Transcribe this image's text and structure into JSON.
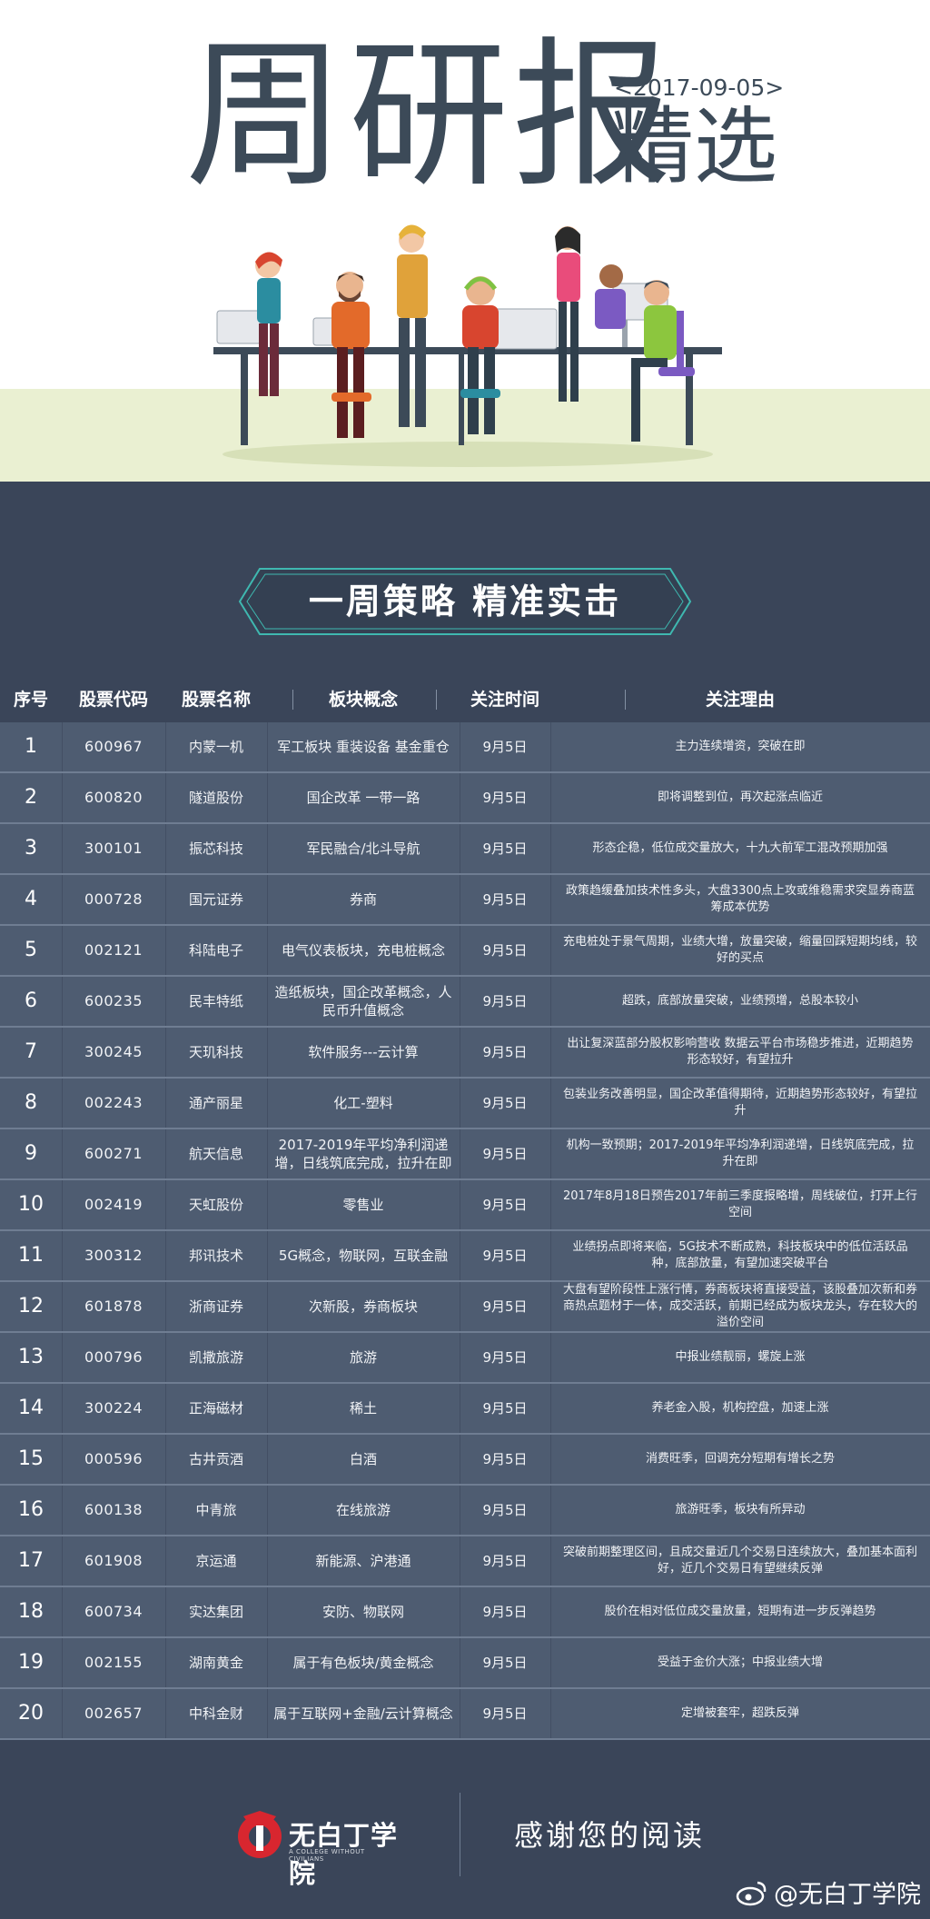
{
  "header": {
    "title_main": "周研报",
    "title_sub": "精选",
    "date": "<2017-09-05>"
  },
  "banner": {
    "text": "一周策略  精准实击"
  },
  "table": {
    "columns": [
      "序号",
      "股票代码",
      "股票名称",
      "板块概念",
      "关注时间",
      "关注理由"
    ],
    "rows": [
      {
        "no": "1",
        "code": "600967",
        "name": "内蒙一机",
        "concept": "军工板块 重装设备 基金重仓",
        "time": "9月5日",
        "reason": "主力连续增资，突破在即"
      },
      {
        "no": "2",
        "code": "600820",
        "name": "隧道股份",
        "concept": "国企改革 一带一路",
        "time": "9月5日",
        "reason": "即将调整到位，再次起涨点临近"
      },
      {
        "no": "3",
        "code": "300101",
        "name": "振芯科技",
        "concept": "军民融合/北斗导航",
        "time": "9月5日",
        "reason": "形态企稳，低位成交量放大，十九大前军工混改预期加强"
      },
      {
        "no": "4",
        "code": "000728",
        "name": "国元证券",
        "concept": "券商",
        "time": "9月5日",
        "reason": "政策趋缓叠加技术性多头，大盘3300点上攻或维稳需求突显券商蓝筹成本优势"
      },
      {
        "no": "5",
        "code": "002121",
        "name": "科陆电子",
        "concept": "电气仪表板块，充电桩概念",
        "time": "9月5日",
        "reason": "充电桩处于景气周期，业绩大增，放量突破，缩量回踩短期均线，较好的买点"
      },
      {
        "no": "6",
        "code": "600235",
        "name": "民丰特纸",
        "concept": "造纸板块，国企改革概念，人民币升值概念",
        "time": "9月5日",
        "reason": "超跌，底部放量突破，业绩预增，总股本较小"
      },
      {
        "no": "7",
        "code": "300245",
        "name": "天玑科技",
        "concept": "软件服务---云计算",
        "time": "9月5日",
        "reason": "出让复深蓝部分股权影响营收 数据云平台市场稳步推进，近期趋势形态较好，有望拉升"
      },
      {
        "no": "8",
        "code": "002243",
        "name": "通产丽星",
        "concept": "化工-塑料",
        "time": "9月5日",
        "reason": "包装业务改善明显，国企改革值得期待，近期趋势形态较好，有望拉升"
      },
      {
        "no": "9",
        "code": "600271",
        "name": "航天信息",
        "concept": "2017-2019年平均净利润递增，日线筑底完成，拉升在即",
        "time": "9月5日",
        "reason": "机构一致预期；2017-2019年平均净利润递增，日线筑底完成，拉升在即"
      },
      {
        "no": "10",
        "code": "002419",
        "name": "天虹股份",
        "concept": "零售业",
        "time": "9月5日",
        "reason": "2017年8月18日预告2017年前三季度报略增，周线破位，打开上行空间"
      },
      {
        "no": "11",
        "code": "300312",
        "name": "邦讯技术",
        "concept": "5G概念，物联网，互联金融",
        "time": "9月5日",
        "reason": "业绩拐点即将来临，5G技术不断成熟，科技板块中的低位活跃品种，底部放量，有望加速突破平台"
      },
      {
        "no": "12",
        "code": "601878",
        "name": "浙商证券",
        "concept": "次新股，券商板块",
        "time": "9月5日",
        "reason": "大盘有望阶段性上涨行情，券商板块将直接受益，该股叠加次新和券商热点题材于一体，成交活跃，前期已经成为板块龙头，存在较大的溢价空间"
      },
      {
        "no": "13",
        "code": "000796",
        "name": "凯撒旅游",
        "concept": "旅游",
        "time": "9月5日",
        "reason": "中报业绩靓丽，螺旋上涨"
      },
      {
        "no": "14",
        "code": "300224",
        "name": "正海磁材",
        "concept": "稀土",
        "time": "9月5日",
        "reason": "养老金入股，机构控盘，加速上涨"
      },
      {
        "no": "15",
        "code": "000596",
        "name": "古井贡酒",
        "concept": "白酒",
        "time": "9月5日",
        "reason": "消费旺季，回调充分短期有增长之势"
      },
      {
        "no": "16",
        "code": "600138",
        "name": "中青旅",
        "concept": "在线旅游",
        "time": "9月5日",
        "reason": "旅游旺季，板块有所异动"
      },
      {
        "no": "17",
        "code": "601908",
        "name": "京运通",
        "concept": "新能源、沪港通",
        "time": "9月5日",
        "reason": "突破前期整理区间，且成交量近几个交易日连续放大，叠加基本面利好，近几个交易日有望继续反弹"
      },
      {
        "no": "18",
        "code": "600734",
        "name": "实达集团",
        "concept": "安防、物联网",
        "time": "9月5日",
        "reason": "股价在相对低位成交量放量，短期有进一步反弹趋势"
      },
      {
        "no": "19",
        "code": "002155",
        "name": "湖南黄金",
        "concept": "属于有色板块/黄金概念",
        "time": "9月5日",
        "reason": "受益于金价大涨；中报业绩大增"
      },
      {
        "no": "20",
        "code": "002657",
        "name": "中科金财",
        "concept": "属于互联网+金融/云计算概念",
        "time": "9月5日",
        "reason": "定增被套牢，超跌反弹"
      }
    ]
  },
  "footer": {
    "logo_text": "无白丁学院",
    "logo_sub": "A COLLEGE WITHOUT CIVILIANS",
    "thanks": "感谢您的阅读",
    "watermark": "@无白丁学院"
  },
  "colors": {
    "dark_bg": "#3a4559",
    "row_bg": "#4e5c71",
    "row_line": "#6f7d92",
    "title": "#3c4a58",
    "floor": "#eaf0d2",
    "logo_red": "#d8262f"
  }
}
